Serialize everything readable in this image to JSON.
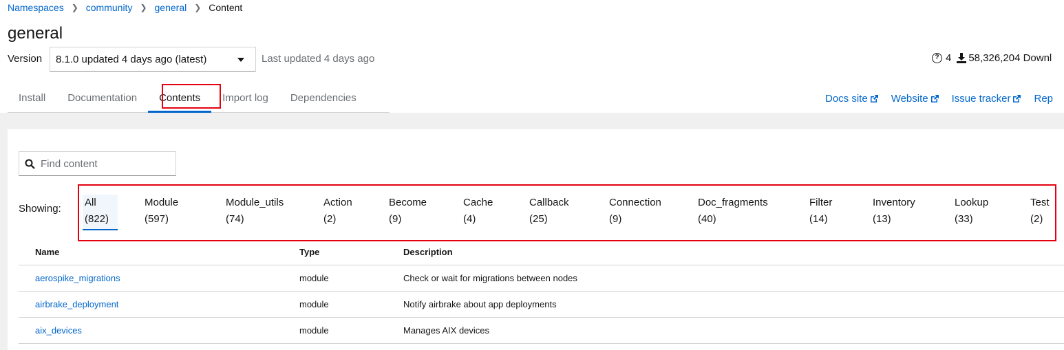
{
  "breadcrumb": [
    "Namespaces",
    "community",
    "general",
    "Content"
  ],
  "title": "general",
  "version": {
    "label": "Version",
    "selected": "8.1.0 updated 4 days ago (latest)",
    "last_updated": "Last updated 4 days ago"
  },
  "stats": {
    "issues": "4",
    "downloads": "58,326,204 Downl"
  },
  "tabs": [
    "Install",
    "Documentation",
    "Contents",
    "Import log",
    "Dependencies"
  ],
  "active_tab": "Contents",
  "external_links": [
    "Docs site",
    "Website",
    "Issue tracker",
    "Rep"
  ],
  "search": {
    "placeholder": "Find content"
  },
  "showing_label": "Showing:",
  "filters": [
    {
      "name": "All",
      "count": "(822)"
    },
    {
      "name": "Module",
      "count": "(597)"
    },
    {
      "name": "Module_utils",
      "count": "(74)"
    },
    {
      "name": "Action",
      "count": "(2)"
    },
    {
      "name": "Become",
      "count": "(9)"
    },
    {
      "name": "Cache",
      "count": "(4)"
    },
    {
      "name": "Callback",
      "count": "(25)"
    },
    {
      "name": "Connection",
      "count": "(9)"
    },
    {
      "name": "Doc_fragments",
      "count": "(40)"
    },
    {
      "name": "Filter",
      "count": "(14)"
    },
    {
      "name": "Inventory",
      "count": "(13)"
    },
    {
      "name": "Lookup",
      "count": "(33)"
    },
    {
      "name": "Test",
      "count": "(2)"
    }
  ],
  "table": {
    "headers": [
      "Name",
      "Type",
      "Description"
    ],
    "rows": [
      [
        "aerospike_migrations",
        "module",
        "Check or wait for migrations between nodes"
      ],
      [
        "airbrake_deployment",
        "module",
        "Notify airbrake about app deployments"
      ],
      [
        "aix_devices",
        "module",
        "Manages AIX devices"
      ]
    ]
  },
  "colors": {
    "link": "#0066cc",
    "highlight": "#e4000f",
    "active_tab": "#0066cc"
  }
}
